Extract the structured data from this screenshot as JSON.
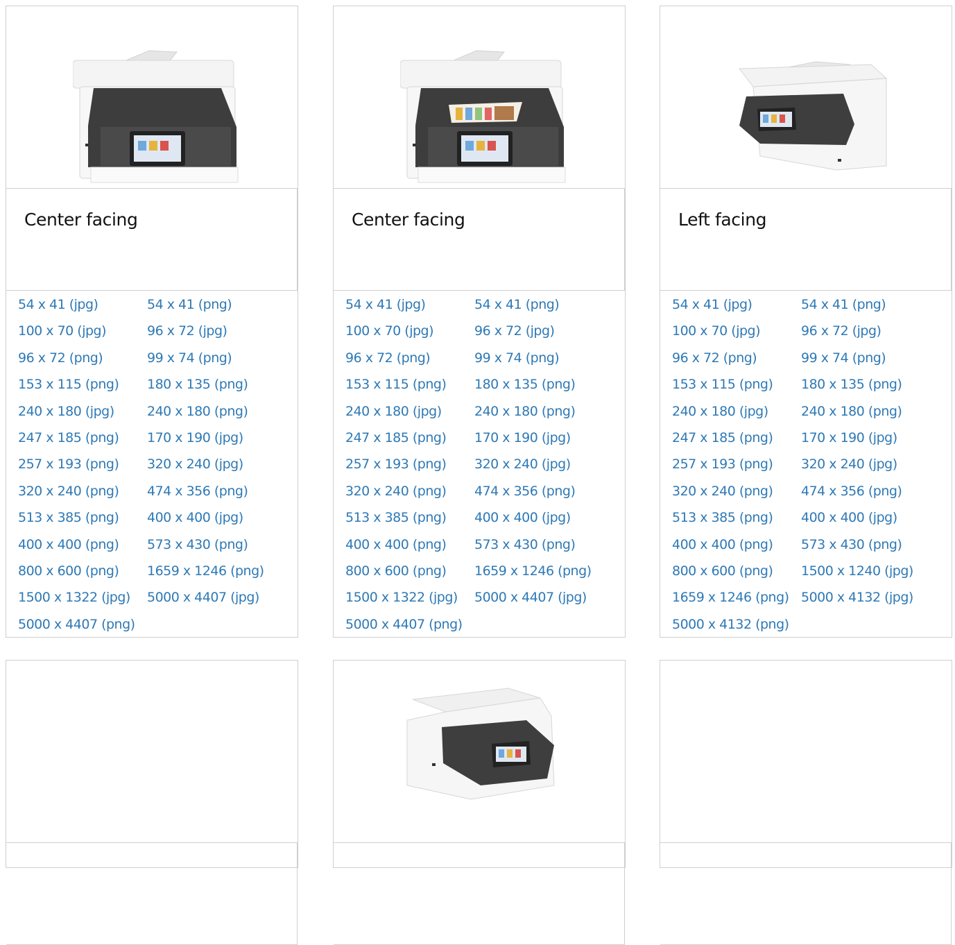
{
  "cards": [
    {
      "title": "Center facing",
      "image": "printer-center-facing-icon",
      "links": [
        "54 x 41 (jpg)",
        "54 x 41 (png)",
        "100 x 70 (jpg)",
        "96 x 72 (jpg)",
        "96 x 72 (png)",
        "99 x 74 (png)",
        "153 x 115 (png)",
        "180 x 135 (png)",
        "240 x 180 (jpg)",
        "240 x 180 (png)",
        "247 x 185 (png)",
        "170 x 190 (jpg)",
        "257 x 193 (png)",
        "320 x 240 (jpg)",
        "320 x 240 (png)",
        "474 x 356 (png)",
        "513 x 385 (png)",
        "400 x 400 (jpg)",
        "400 x 400 (png)",
        "573 x 430 (png)",
        "800 x 600 (png)",
        "1659 x 1246 (png)",
        "1500 x 1322 (jpg)",
        "5000 x 4407 (jpg)",
        "5000 x 4407 (png)"
      ]
    },
    {
      "title": "Center facing",
      "image": "printer-center-facing-with-paper-icon",
      "links": [
        "54 x 41 (jpg)",
        "54 x 41 (png)",
        "100 x 70 (jpg)",
        "96 x 72 (jpg)",
        "96 x 72 (png)",
        "99 x 74 (png)",
        "153 x 115 (png)",
        "180 x 135 (png)",
        "240 x 180 (jpg)",
        "240 x 180 (png)",
        "247 x 185 (png)",
        "170 x 190 (jpg)",
        "257 x 193 (png)",
        "320 x 240 (jpg)",
        "320 x 240 (png)",
        "474 x 356 (png)",
        "513 x 385 (png)",
        "400 x 400 (jpg)",
        "400 x 400 (png)",
        "573 x 430 (png)",
        "800 x 600 (png)",
        "1659 x 1246 (png)",
        "1500 x 1322 (jpg)",
        "5000 x 4407 (jpg)",
        "5000 x 4407 (png)"
      ]
    },
    {
      "title": "Left facing",
      "image": "printer-left-facing-icon",
      "links": [
        "54 x 41 (jpg)",
        "54 x 41 (png)",
        "100 x 70 (jpg)",
        "96 x 72 (jpg)",
        "96 x 72 (png)",
        "99 x 74 (png)",
        "153 x 115 (png)",
        "180 x 135 (png)",
        "240 x 180 (jpg)",
        "240 x 180 (png)",
        "247 x 185 (png)",
        "170 x 190 (jpg)",
        "257 x 193 (png)",
        "320 x 240 (jpg)",
        "320 x 240 (png)",
        "474 x 356 (png)",
        "513 x 385 (png)",
        "400 x 400 (jpg)",
        "400 x 400 (png)",
        "573 x 430 (png)",
        "800 x 600 (png)",
        "1500 x 1240 (jpg)",
        "1659 x 1246 (png)",
        "5000 x 4132 (jpg)",
        "5000 x 4132 (png)"
      ]
    },
    {
      "title": "",
      "image": "",
      "links": []
    },
    {
      "title": "",
      "image": "printer-right-facing-icon",
      "links": []
    },
    {
      "title": "",
      "image": "",
      "links": []
    }
  ],
  "colors": {
    "link": "#2e79b5",
    "border": "#cfcfcf",
    "title": "#111111"
  }
}
